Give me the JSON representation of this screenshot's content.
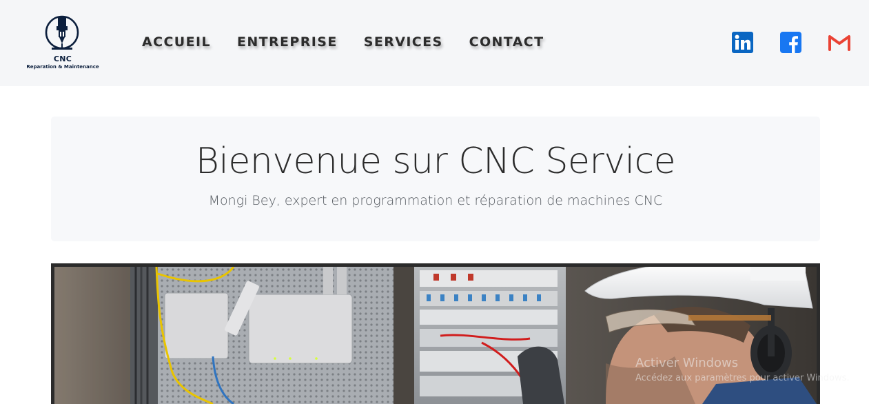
{
  "header": {
    "logo": {
      "name": "CNC",
      "tagline": "Reparation & Maintenance",
      "icon": "cnc-spindle-icon"
    },
    "nav": [
      {
        "label": "ACCUEIL"
      },
      {
        "label": "ENTREPRISE"
      },
      {
        "label": "SERVICES"
      },
      {
        "label": "CONTACT"
      }
    ],
    "social": [
      {
        "icon": "linkedin-icon",
        "color": "#0a66c2"
      },
      {
        "icon": "facebook-icon",
        "color": "#1877f2"
      },
      {
        "icon": "gmail-icon",
        "color": "#ea4335"
      }
    ]
  },
  "hero": {
    "title": "Bienvenue sur CNC Service",
    "subtitle": "Mongi Bey, expert en programmation et réparation de machines CNC"
  },
  "banner": {
    "image": "technician-electrical-panel-photo"
  },
  "watermark": {
    "title": "Activer Windows",
    "subtitle": "Accédez aux paramètres pour activer Windows."
  },
  "colors": {
    "header_bg": "#f5f6f8",
    "nav_text": "#2c2c2c",
    "hero_bg": "#f7f8fa",
    "banner_frame": "#2b2b2b"
  }
}
